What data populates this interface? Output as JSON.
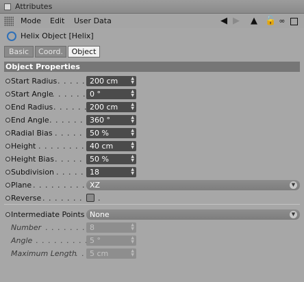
{
  "window": {
    "title": "Attributes"
  },
  "menu": {
    "items": [
      "Mode",
      "Edit",
      "User Data"
    ]
  },
  "header_icons": [
    "back-arrow-icon",
    "forward-arrow-icon",
    "up-arrow-icon",
    "lock-icon",
    "new-link-icon",
    "new-window-icon"
  ],
  "object": {
    "title": "Helix Object [Helix]"
  },
  "tabs": {
    "basic": "Basic",
    "coord": "Coord.",
    "object": "Object"
  },
  "section": {
    "title": "Object Properties"
  },
  "fields": {
    "start_radius": {
      "label": "Start Radius",
      "value": "200 cm"
    },
    "start_angle": {
      "label": "Start Angle",
      "value": "0 °"
    },
    "end_radius": {
      "label": "End Radius",
      "value": "200 cm"
    },
    "end_angle": {
      "label": "End Angle",
      "value": "360 °"
    },
    "radial_bias": {
      "label": "Radial Bias",
      "value": "50 %"
    },
    "height": {
      "label": "Height",
      "value": "40 cm"
    },
    "height_bias": {
      "label": "Height Bias",
      "value": "50 %"
    },
    "subdivision": {
      "label": "Subdivision",
      "value": "18"
    },
    "plane": {
      "label": "Plane",
      "value": "XZ"
    },
    "reverse": {
      "label": "Reverse",
      "checked": false
    },
    "intermediate_points": {
      "label": "Intermediate Points",
      "value": "None"
    },
    "number": {
      "label": "Number",
      "value": "8"
    },
    "angle": {
      "label": "Angle",
      "value": "5 °"
    },
    "maximum_length": {
      "label": "Maximum Length",
      "value": "5 cm"
    }
  }
}
